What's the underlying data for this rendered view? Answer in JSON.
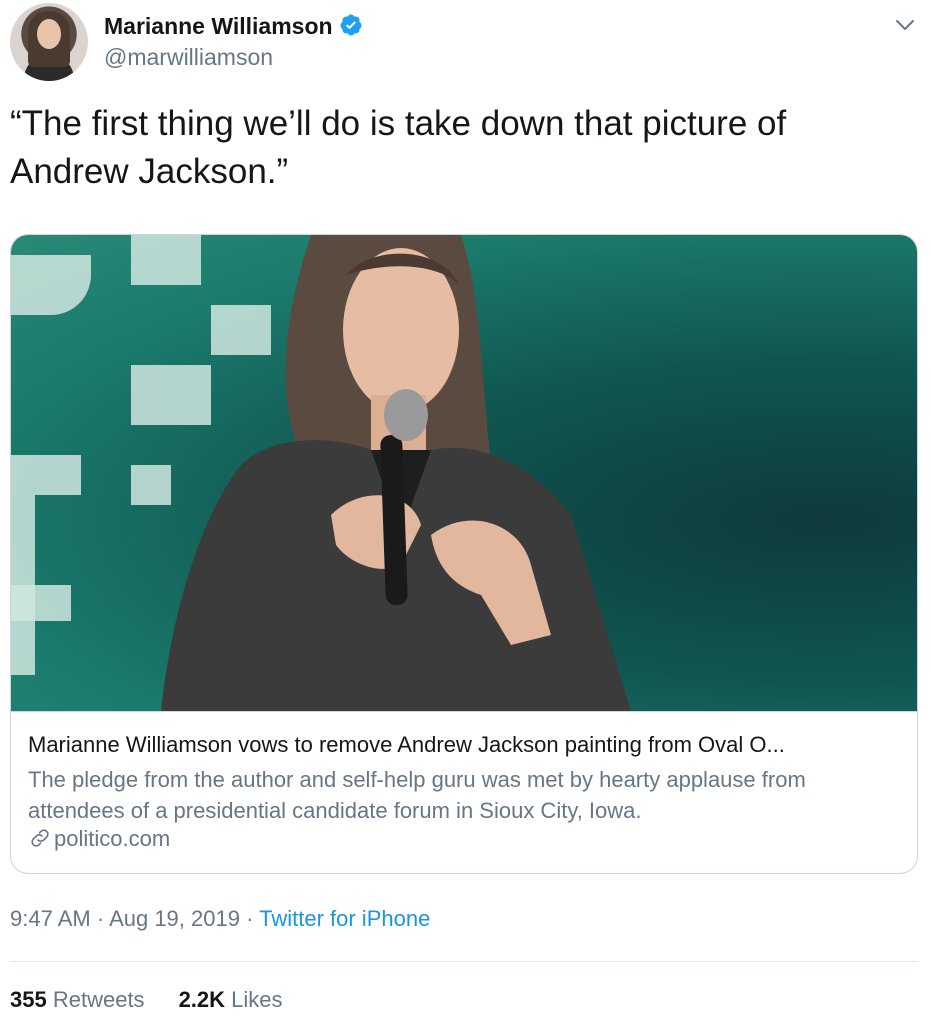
{
  "author": {
    "name": "Marianne Williamson",
    "handle": "@marwilliamson",
    "verified_icon": "verified-badge-icon",
    "avatar_icon": "avatar"
  },
  "tweet": {
    "text": "“The first thing we’ll do is take down that picture of Andrew Jackson.”"
  },
  "card": {
    "title": "Marianne Williamson vows to remove Andrew Jackson painting from Oval O...",
    "description": "The pledge from the author and self-help guru was met by hearty applause from attendees of a presidential candidate forum in Sioux City, Iowa.",
    "domain": "politico.com",
    "link_icon": "link-icon"
  },
  "meta": {
    "time": "9:47 AM",
    "separator": " · ",
    "date": "Aug 19, 2019",
    "source": "Twitter for iPhone"
  },
  "stats": {
    "retweets_count": "355",
    "retweets_label": "Retweets",
    "likes_count": "2.2K",
    "likes_label": "Likes"
  },
  "colors": {
    "accent": "#1b95e0",
    "secondary_text": "#657786",
    "verified": "#1da1f2"
  }
}
